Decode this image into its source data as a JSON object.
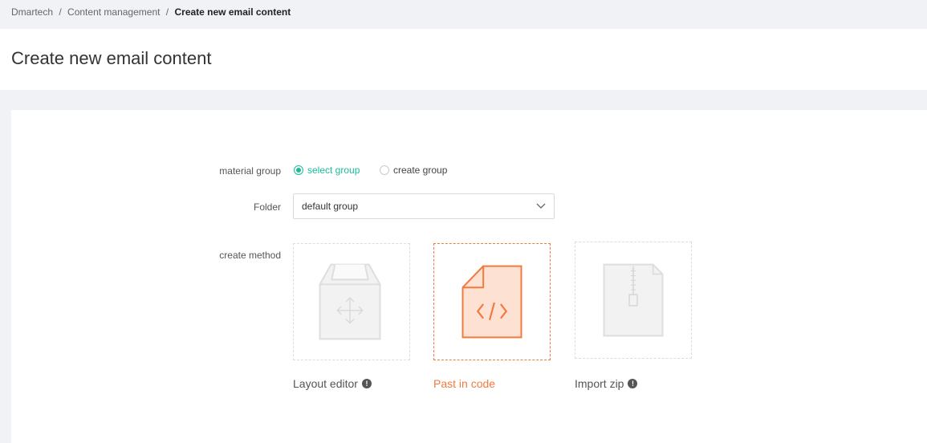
{
  "breadcrumb": {
    "items": [
      "Dmartech",
      "Content management"
    ],
    "separator": "/",
    "current": "Create new email content"
  },
  "page": {
    "title": "Create new email content"
  },
  "form": {
    "material_group_label": "material group",
    "radios": [
      {
        "label": "select group",
        "checked": true
      },
      {
        "label": "create group",
        "checked": false
      }
    ],
    "folder_label": "Folder",
    "folder_value": "default group",
    "create_method_label": "create method",
    "methods": [
      {
        "label": "Layout editor",
        "icon": "layout-box-icon",
        "info": true,
        "selected": false
      },
      {
        "label": "Past in code",
        "icon": "code-file-icon",
        "info": false,
        "selected": true
      },
      {
        "label": "Import zip",
        "icon": "zip-file-icon",
        "info": true,
        "selected": false
      }
    ],
    "info_glyph": "!"
  },
  "colors": {
    "accent": "#1abc9c",
    "selected": "#f27a3f"
  }
}
